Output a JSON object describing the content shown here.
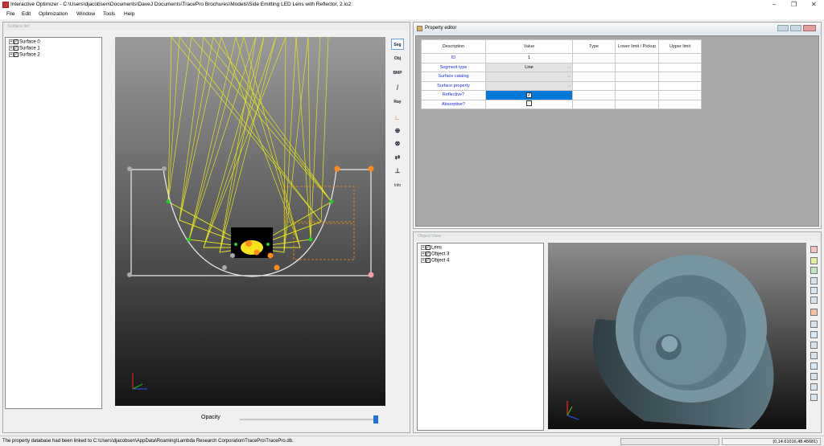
{
  "window": {
    "title": "Interactive Optimizer - C:\\Users\\djacobsen\\Documents\\DaveJ Documents\\TracePro Brochures\\Models\\Side Emitting LED Lens with Reflector, 2.io2",
    "minimize": "–",
    "restore": "❐",
    "close": "✕"
  },
  "menu": [
    "File",
    "Edit",
    "Optimization",
    "Window",
    "Tools",
    "Help"
  ],
  "surface_list": {
    "title": "Surface list",
    "items": [
      "Surface 0",
      "Surface 1",
      "Surface 2"
    ]
  },
  "toolbar": {
    "buttons": [
      "Seg",
      "Obj",
      "BMP",
      "Ray"
    ],
    "info_label": "Info",
    "icons": [
      "ruler-icon",
      "angle-icon",
      "zoom-in-icon",
      "zoom-extents-icon",
      "reverse-icon",
      "axis-icon"
    ]
  },
  "opacity": {
    "label": "Opacity",
    "value": 1.0
  },
  "property_editor": {
    "title": "Property editor",
    "headers": [
      "Description",
      "Value",
      "Type",
      "Lower limit / Pickup",
      "Upper limit"
    ],
    "rows": [
      {
        "description": "ID",
        "value": "1"
      },
      {
        "description": "Segment type",
        "value": "Line"
      },
      {
        "description": "Surface catalog",
        "value": ""
      },
      {
        "description": "Surface property",
        "value": ""
      },
      {
        "description": "Reflective?",
        "checked": true
      },
      {
        "description": "Absorptive?",
        "checked": false
      }
    ]
  },
  "object_view": {
    "title": "Object View",
    "items": [
      "Lens",
      "Object 3",
      "Object 4"
    ]
  },
  "status": {
    "message": "The property database had been linked to C:\\Users\\djacobsen\\AppData\\Roaming\\Lambda Research Corporation\\TracePro\\TracePro.db.",
    "coords": "(0,14.61016,48.45681)"
  },
  "colors": {
    "rays": "#e6e61e",
    "selection": "#0078d7",
    "model": "#6f8a95",
    "point_orange": "#ff8c1a",
    "point_green": "#22cc22"
  }
}
